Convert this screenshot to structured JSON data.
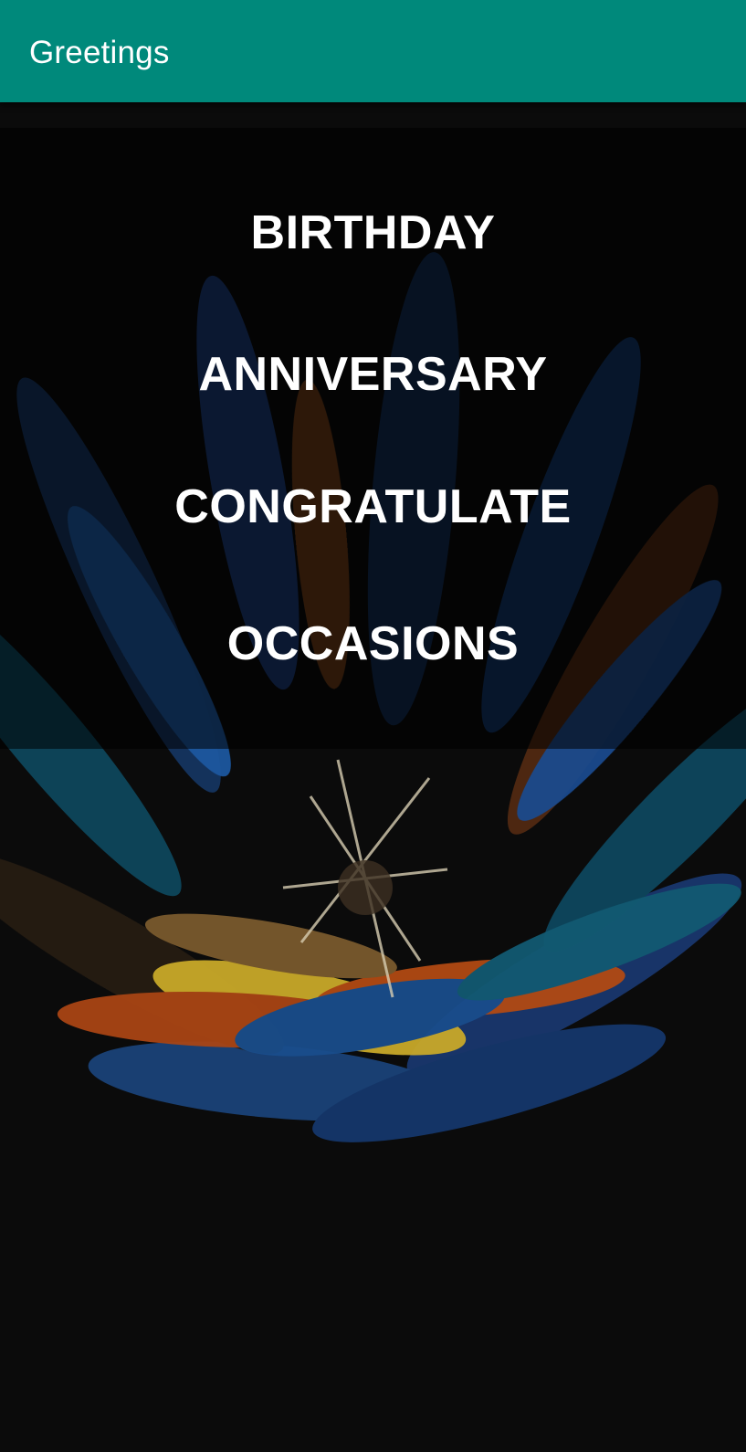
{
  "app_bar": {
    "title": "Greetings",
    "color": "#00897b"
  },
  "menu": {
    "items": [
      {
        "label": "BIRTHDAY"
      },
      {
        "label": "ANNIVERSARY"
      },
      {
        "label": "CONGRATULATE"
      },
      {
        "label": "OCCASIONS"
      }
    ]
  },
  "background": {
    "icon": "feather-burst-wallpaper",
    "feather_colors": [
      "#1f4e8c",
      "#0f5f74",
      "#b9531a",
      "#d4b21c",
      "#6b3a1a"
    ]
  }
}
